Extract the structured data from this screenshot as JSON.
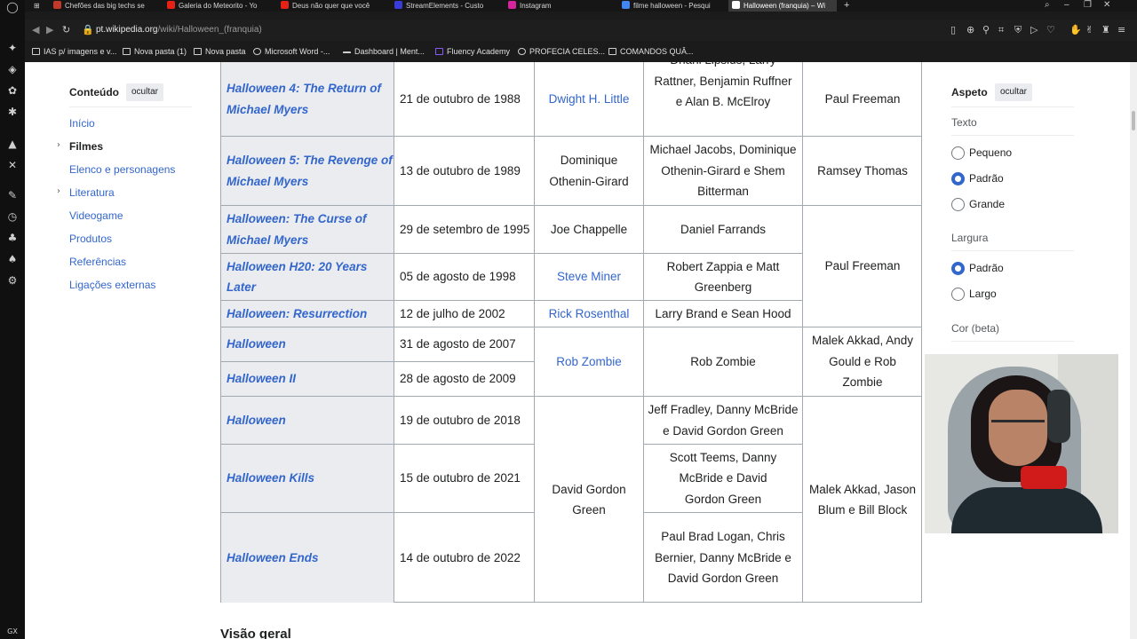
{
  "tabs": [
    {
      "label": "Chefões das big techs se",
      "color": "#c0392b"
    },
    {
      "label": "Galeria do Meteorito - Yo",
      "color": "#e62117"
    },
    {
      "label": "Deus não quer que você",
      "color": "#e62117"
    },
    {
      "label": "StreamElements - Custo",
      "color": "#3b3bd9"
    },
    {
      "label": "Instagram",
      "color": "#d6249f"
    },
    {
      "label": "filme halloween - Pesqui",
      "color": "#4285f4"
    },
    {
      "label": "Halloween (franquia) – Wi",
      "color": "#ffffff"
    }
  ],
  "new_tab": "+",
  "address": {
    "domain": "pt.wikipedia.org",
    "path": "/wiki/Halloween_(franquia)"
  },
  "bookmarks": [
    "IAS p/ imagens e v...",
    "Nova pasta (1)",
    "Nova pasta",
    "Microsoft Word -...",
    "Dashboard | Ment...",
    "Fluency Academy",
    "PROFECIA CELES...",
    "COMANDOS QUÂ..."
  ],
  "toc": {
    "title": "Conteúdo",
    "hide_label": "ocultar",
    "items": [
      "Início",
      "Filmes",
      "Elenco e personagens",
      "Literatura",
      "Videogame",
      "Produtos",
      "Referências",
      "Ligações externas"
    ]
  },
  "films": {
    "rows": [
      {
        "title": "Halloween 4: The Return of Michael Myers",
        "date": "21 de outubro de 1988",
        "director": "Dwight H. Little",
        "writers": "Dhani Lipsius, Larry Rattner, Benjamin Ruffner e Alan B. McElroy",
        "producer": "Paul Freeman"
      },
      {
        "title": "Halloween 5: The Revenge of Michael Myers",
        "date": "13 de outubro de 1989",
        "director": "Dominique Othenin-Girard",
        "writers": "Michael Jacobs, Dominique Othenin-Girard e Shem Bitterman",
        "producer": "Ramsey Thomas"
      },
      {
        "title": "Halloween: The Curse of Michael Myers",
        "date": "29 de setembro de 1995",
        "director": "Joe Chappelle",
        "writers": "Daniel Farrands"
      },
      {
        "title": "Halloween H20: 20 Years Later",
        "date": "05 de agosto de 1998",
        "director": "Steve Miner",
        "writers": "Robert Zappia e Matt Greenberg"
      },
      {
        "title": "Halloween: Resurrection",
        "date": "12 de julho de 2002",
        "director": "Rick Rosenthal",
        "writers": "Larry Brand e Sean Hood"
      },
      {
        "title": "Halloween",
        "date": "31 de agosto de 2007"
      },
      {
        "title": "Halloween II",
        "date": "28 de agosto de 2009"
      },
      {
        "title": "Halloween",
        "date": "19 de outubro de 2018",
        "writers": "Jeff Fradley, Danny McBride e David Gordon Green"
      },
      {
        "title": "Halloween Kills",
        "date": "15 de outubro de 2021",
        "writers": "Scott Teems, Danny McBride e David Gordon Green"
      },
      {
        "title": "Halloween Ends",
        "date": "14 de outubro de 2022",
        "writers": "Paul Brad Logan, Chris Bernier, Danny McBride e David Gordon Green"
      }
    ],
    "merged": {
      "producer_paul": "Paul Freeman",
      "rob_director": "Rob Zombie",
      "rob_writer": "Rob Zombie",
      "rob_producer": "Malek Akkad, Andy Gould e Rob Zombie",
      "dgg_director": "David Gordon Green",
      "dgg_producer": "Malek Akkad, Jason Blum e Bill Block"
    }
  },
  "next_heading": "Visão geral",
  "appearance": {
    "title": "Aspeto",
    "hide_label": "ocultar",
    "text_label": "Texto",
    "text_options": [
      "Pequeno",
      "Padrão",
      "Grande"
    ],
    "text_selected": "Padrão",
    "width_label": "Largura",
    "width_options": [
      "Padrão",
      "Largo"
    ],
    "width_selected": "Padrão",
    "color_label": "Cor (beta)"
  },
  "colors": {
    "link": "#3366cc",
    "title_cell_bg": "#eaecf0",
    "border": "#a2a9b1"
  }
}
